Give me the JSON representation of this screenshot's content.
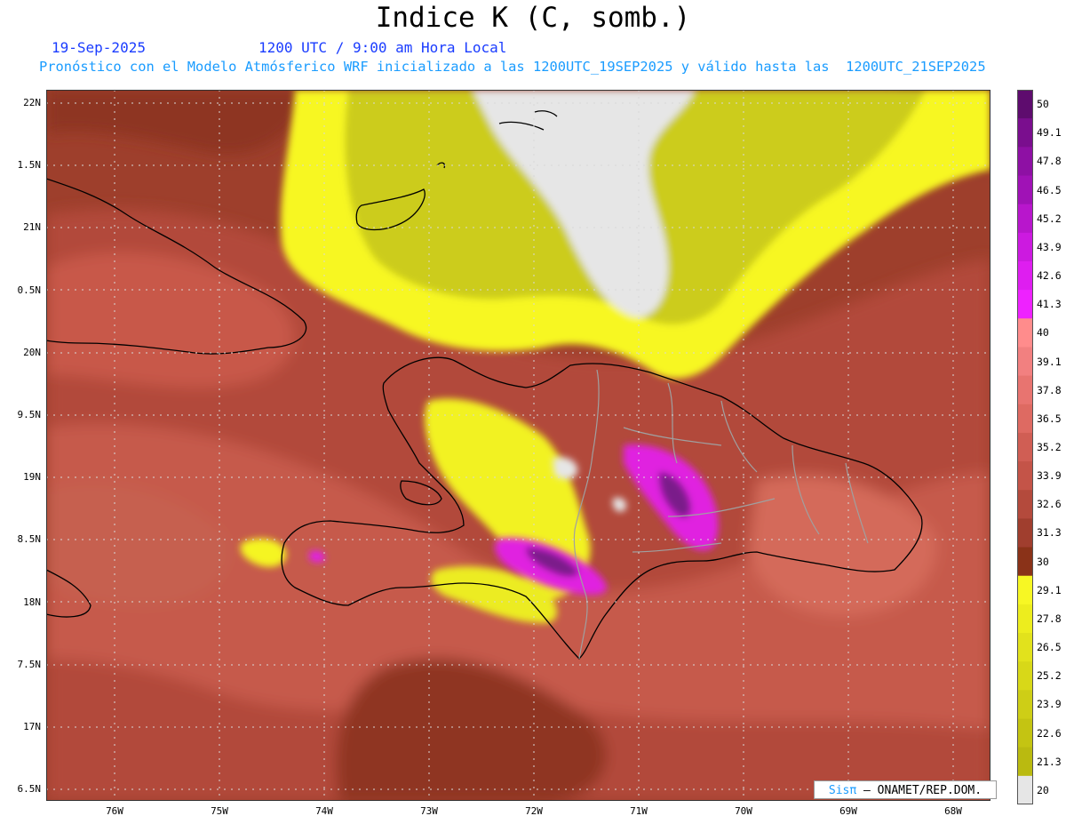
{
  "title": "Indice K (C, somb.)",
  "date": "19-Sep-2025",
  "time": "1200 UTC / 9:00 am Hora Local",
  "subtitle": "Pronóstico con el Modelo Atmósferico WRF inicializado a las 1200UTC_19SEP2025 y válido hasta las  1200UTC_21SEP2025",
  "credit": {
    "brand": "Sisπ",
    "text": "– ONAMET/REP.DOM."
  },
  "map": {
    "lat_labels": [
      "22N",
      "1.5N",
      "21N",
      "0.5N",
      "20N",
      "9.5N",
      "19N",
      "8.5N",
      "18N",
      "7.5N",
      "17N",
      "6.5N"
    ],
    "lon_labels": [
      "76W",
      "75W",
      "74W",
      "73W",
      "72W",
      "71W",
      "70W",
      "69W",
      "68W"
    ],
    "grid": "dotted",
    "colors": {
      "background_low": "#8b3318",
      "mid": "#b54d3e",
      "high": "#d9665a",
      "peak": "#e8807a",
      "yellow": "#f5f524",
      "olive": "#c8c818",
      "gray": "#e6e6e6",
      "magenta": "#ee22ee",
      "purple": "#7a1a8a",
      "coast": "#000000",
      "border": "#a0a0a0"
    }
  },
  "colorbar": {
    "labels": [
      "50",
      "49.1",
      "47.8",
      "46.5",
      "45.2",
      "43.9",
      "42.6",
      "41.3",
      "40",
      "39.1",
      "37.8",
      "36.5",
      "35.2",
      "33.9",
      "32.6",
      "31.3",
      "30",
      "29.1",
      "27.8",
      "26.5",
      "25.2",
      "23.9",
      "22.6",
      "21.3",
      "20"
    ],
    "colors": [
      "#5e0c6e",
      "#7a0e8e",
      "#8e10a4",
      "#a012b6",
      "#b816cc",
      "#cc1ae0",
      "#de1ef0",
      "#ee22ff",
      "#ff8c8c",
      "#f28080",
      "#e87470",
      "#de6a62",
      "#d05e54",
      "#c45448",
      "#b44a3c",
      "#a03e2e",
      "#8a3218",
      "#f7f724",
      "#eded1e",
      "#e2e21c",
      "#d8d818",
      "#cece16",
      "#c4c412",
      "#baba10",
      "#e6e6e6"
    ]
  }
}
